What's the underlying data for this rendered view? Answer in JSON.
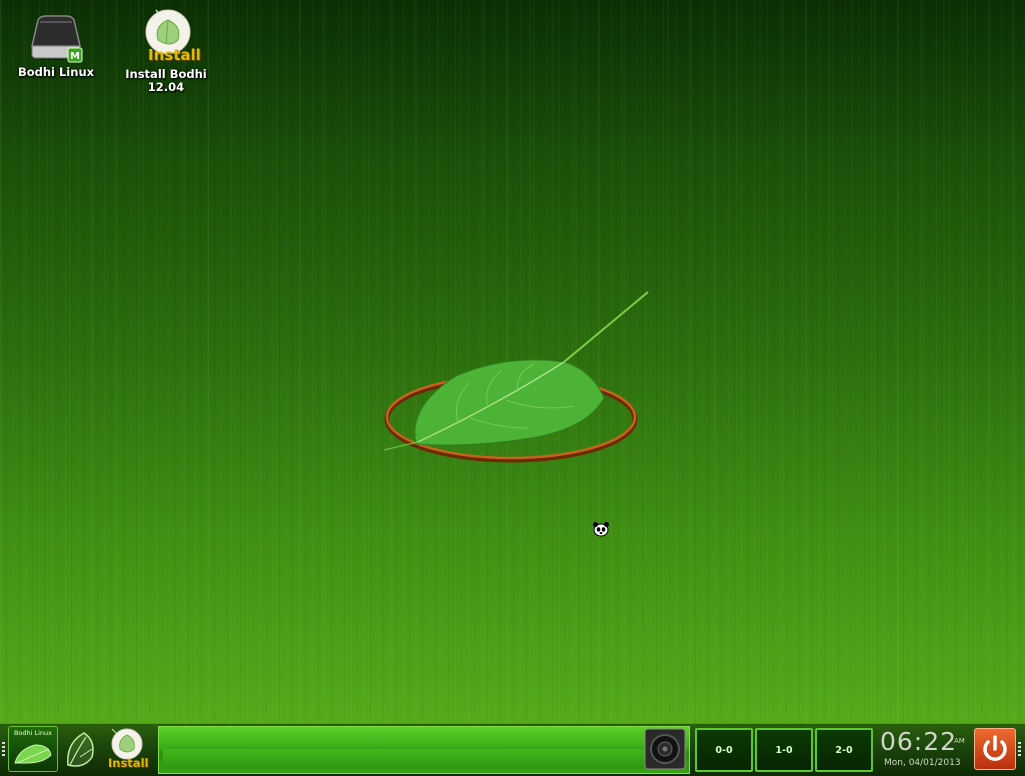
{
  "desktop": {
    "icons": [
      {
        "label": "Bodhi Linux"
      },
      {
        "label": "Install Bodhi\n12.04",
        "overlay": "Install"
      }
    ],
    "background_color": "#2c700e"
  },
  "taskbar": {
    "start_button_label": "Bodhi Linux",
    "install_launcher_text": "Install",
    "desktops": [
      "0-0",
      "1-0",
      "2-0"
    ],
    "clock_time": "06:22",
    "clock_ampm": "AM",
    "clock_date": "Mon, 04/01/2013",
    "accent_color": "#5ec72a",
    "power_color": "#d84a1c"
  }
}
